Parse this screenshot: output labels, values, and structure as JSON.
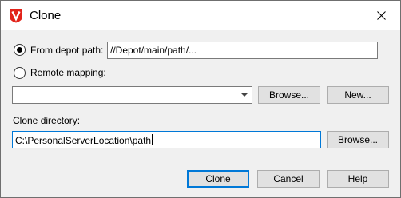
{
  "window": {
    "title": "Clone"
  },
  "source": {
    "depot_path_label": "From depot path:",
    "depot_path_value": "//Depot/main/path/...",
    "depot_path_selected": true,
    "remote_mapping_label": "Remote mapping:",
    "remote_mapping_selected": false,
    "remote_mapping_value": "",
    "browse_label": "Browse...",
    "new_label": "New..."
  },
  "clone_directory": {
    "label": "Clone directory:",
    "value": "C:\\PersonalServerLocation\\path",
    "browse_label": "Browse..."
  },
  "footer": {
    "clone_label": "Clone",
    "cancel_label": "Cancel",
    "help_label": "Help"
  },
  "colors": {
    "logo_red": "#e2231a",
    "focus_blue": "#0078d7"
  }
}
